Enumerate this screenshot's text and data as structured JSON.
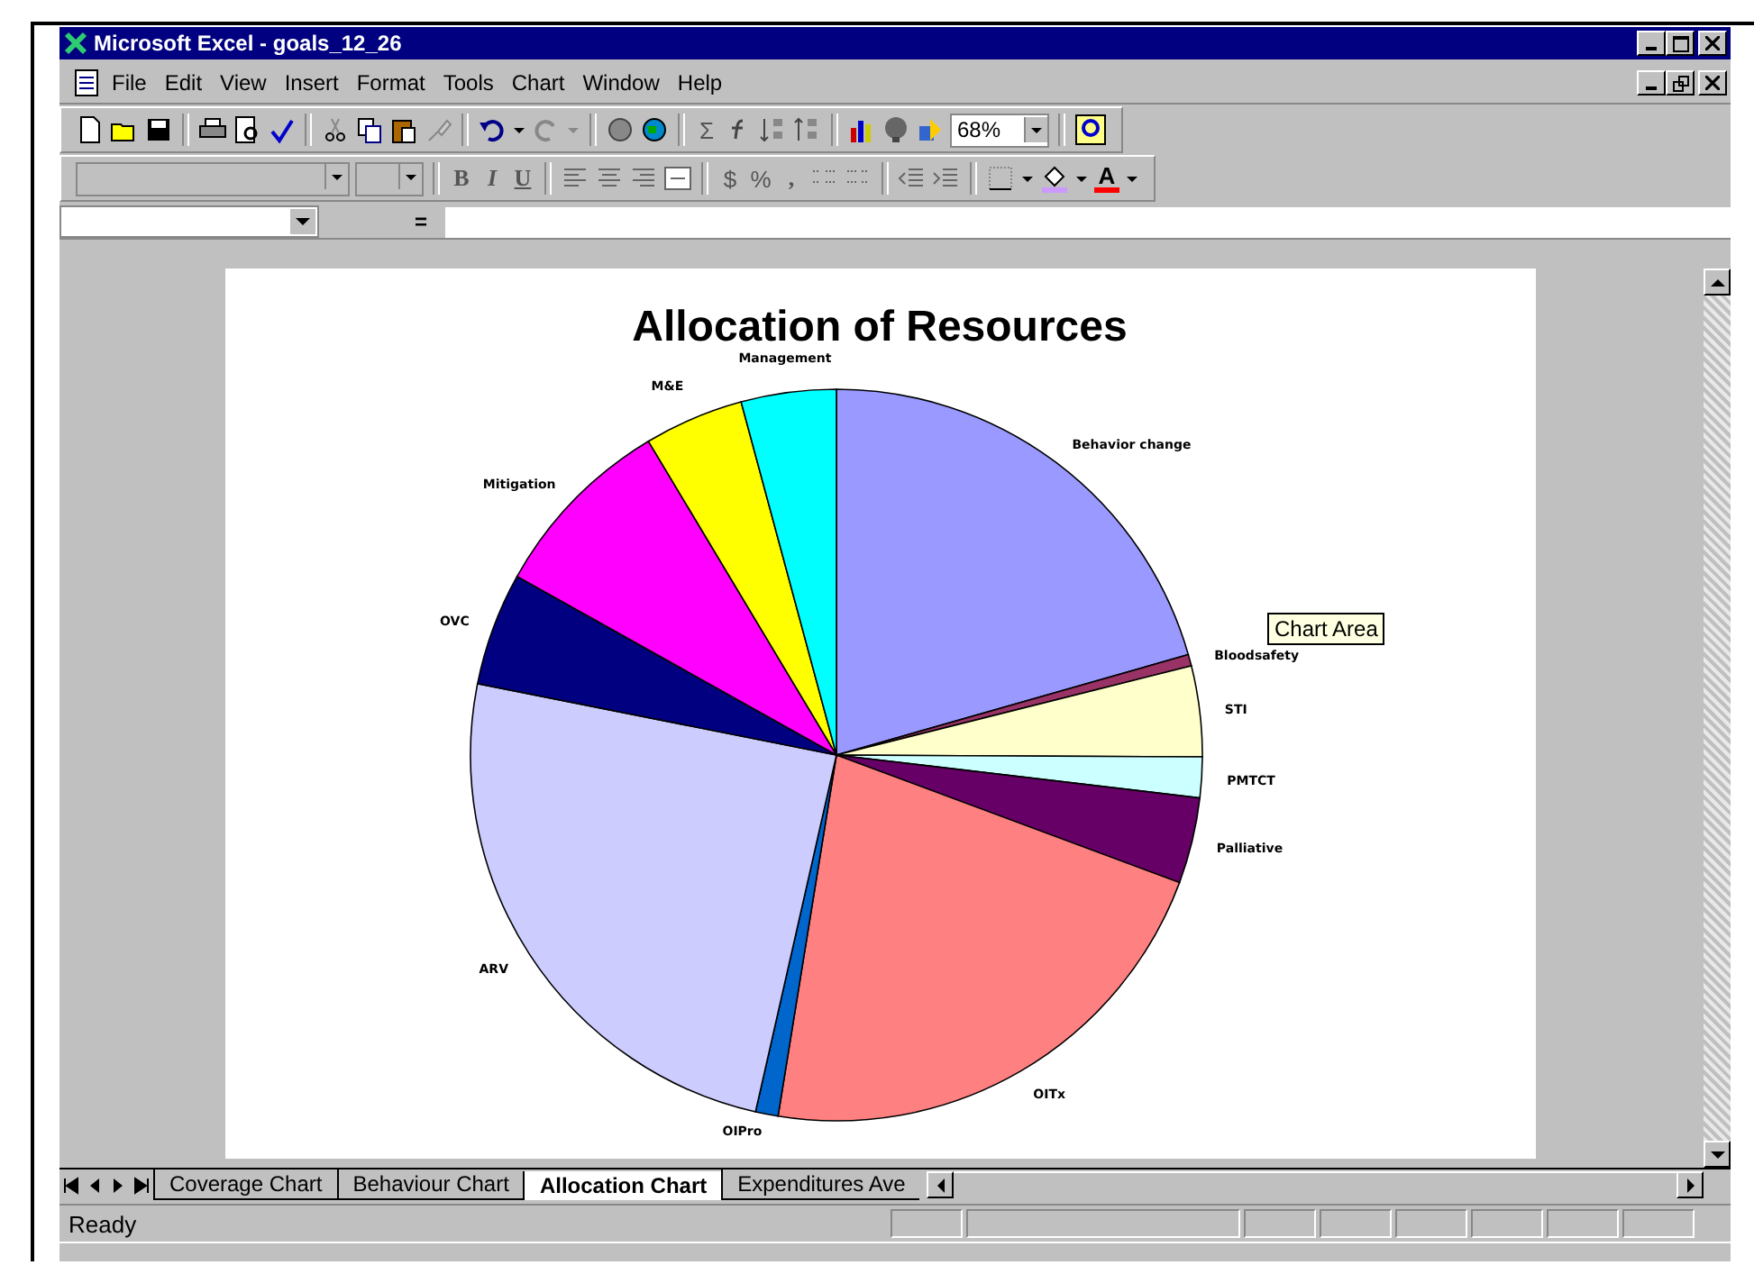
{
  "window": {
    "title": "Microsoft Excel - goals_12_26"
  },
  "menu": [
    "File",
    "Edit",
    "View",
    "Insert",
    "Format",
    "Tools",
    "Chart",
    "Window",
    "Help"
  ],
  "standard_toolbar": {
    "sum": "Σ",
    "zoom": "68%"
  },
  "formatting_toolbar": {
    "bold": "B",
    "italic": "I",
    "underline": "U",
    "currency": "$",
    "percent": "%",
    "comma": ",",
    "font_color": "A"
  },
  "formula_bar": {
    "equals": "="
  },
  "chart": {
    "chart_data": {
      "type": "pie",
      "title": "Allocation of Resources",
      "categories": [
        "Behavior change",
        "Bloodsafety",
        "STI",
        "PMTCT",
        "Palliative",
        "OITx",
        "OIPro",
        "ARV",
        "OVC",
        "Mitigation",
        "M&E",
        "Management"
      ],
      "values": [
        20.6,
        0.5,
        4,
        1.8,
        3.8,
        21.9,
        1,
        24.6,
        5,
        8.3,
        4.4,
        4.2
      ],
      "colors": [
        "#9999ff",
        "#993366",
        "#ffffcc",
        "#ccffff",
        "#660066",
        "#ff8080",
        "#0066cc",
        "#ccccff",
        "#000080",
        "#ff00ff",
        "#ffff00",
        "#00ffff"
      ]
    }
  },
  "tooltip": "Chart Area",
  "sheet_tabs": [
    {
      "label": "Coverage Chart",
      "selected": false
    },
    {
      "label": "Behaviour Chart",
      "selected": false
    },
    {
      "label": "Allocation Chart",
      "selected": true
    },
    {
      "label": "Expenditures Ave",
      "selected": false
    }
  ],
  "status_bar": "Ready"
}
